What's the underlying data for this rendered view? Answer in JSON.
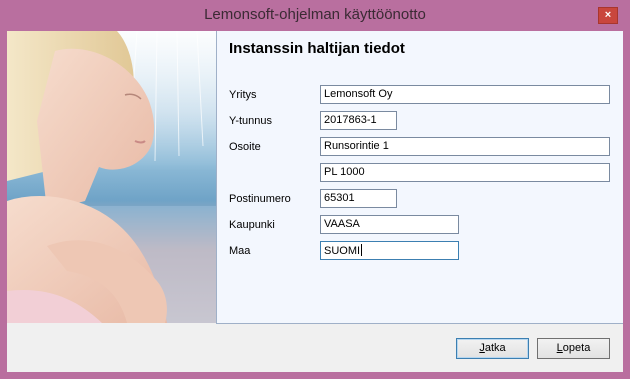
{
  "window": {
    "title": "Lemonsoft-ohjelman käyttöönotto",
    "close_glyph": "×",
    "colors": {
      "frame": "#b96f9f",
      "panel": "#f3f7fe",
      "close": "#c9463d"
    }
  },
  "photo": {
    "icon": "woman-photo"
  },
  "form": {
    "heading": "Instanssin haltijan tiedot",
    "fields": {
      "yritys": {
        "label": "Yritys",
        "value": "Lemonsoft Oy"
      },
      "ytunnus": {
        "label": "Y-tunnus",
        "value": "2017863-1"
      },
      "osoite": {
        "label": "Osoite",
        "value": "Runsorintie 1",
        "value2": "PL 1000"
      },
      "postinumero": {
        "label": "Postinumero",
        "value": "65301"
      },
      "kaupunki": {
        "label": "Kaupunki",
        "value": "VAASA"
      },
      "maa": {
        "label": "Maa",
        "value": "SUOMI"
      }
    }
  },
  "buttons": {
    "jatka": {
      "mnemonic": "J",
      "rest": "atka"
    },
    "lopeta": {
      "mnemonic": "L",
      "rest": "opeta"
    }
  }
}
